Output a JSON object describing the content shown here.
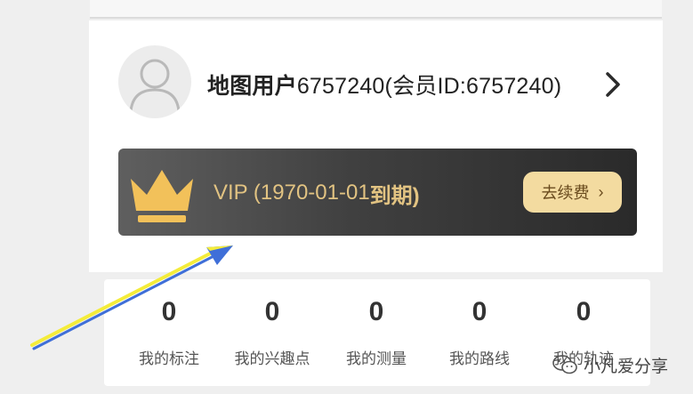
{
  "profile": {
    "username": "地图用户",
    "user_suffix": "6757240(会员ID:6757240)"
  },
  "vip": {
    "status_prefix": "VIP (1970-01-01",
    "status_suffix": "到期)",
    "renew_label": "去续费",
    "renew_arrow": "›"
  },
  "stats": [
    {
      "count": "0",
      "label": "我的标注"
    },
    {
      "count": "0",
      "label": "我的兴趣点"
    },
    {
      "count": "0",
      "label": "我的测量"
    },
    {
      "count": "0",
      "label": "我的路线"
    },
    {
      "count": "0",
      "label": "我的轨迹"
    }
  ],
  "watermark": {
    "text": "小凡爱分享"
  },
  "colors": {
    "vip_gold": "#e2c382",
    "renew_bg": "#f3dba0",
    "arrow_blue": "#3f6fd8",
    "arrow_yellow": "#f4ec3a"
  }
}
